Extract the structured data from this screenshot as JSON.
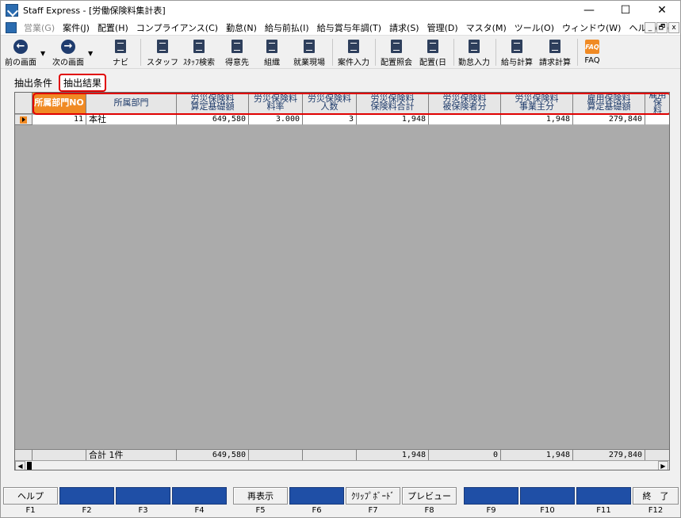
{
  "window": {
    "title": "Staff Express - [労働保険料集計表]",
    "controls": [
      "—",
      "☐",
      "✕"
    ]
  },
  "menu": {
    "items": [
      {
        "label": "営業(G)",
        "disabled": true
      },
      {
        "label": "案件(J)",
        "disabled": false
      },
      {
        "label": "配置(H)",
        "disabled": false
      },
      {
        "label": "コンプライアンス(C)",
        "disabled": false
      },
      {
        "label": "勤怠(N)",
        "disabled": false
      },
      {
        "label": "給与前払(I)",
        "disabled": false
      },
      {
        "label": "給与賞与年調(T)",
        "disabled": false
      },
      {
        "label": "請求(S)",
        "disabled": false
      },
      {
        "label": "管理(D)",
        "disabled": false
      },
      {
        "label": "マスタ(M)",
        "disabled": false
      },
      {
        "label": "ツール(O)",
        "disabled": false
      },
      {
        "label": "ウィンドウ(W)",
        "disabled": false
      },
      {
        "label": "ヘルプ(H)",
        "disabled": false
      }
    ],
    "mdi_controls": [
      "_",
      "🗗",
      "x"
    ]
  },
  "toolbar": {
    "back": "前の画面",
    "forward": "次の画面",
    "navi": "ナビ",
    "staff": "スタッフ",
    "staff_search": "ｽﾀｯﾌ検索",
    "client": "得意先",
    "org": "組織",
    "worksite": "就業現場",
    "case_input": "案件入力",
    "assign_inquiry": "配置照会",
    "assign_day": "配置(日",
    "attendance_input": "勤怠入力",
    "payroll_calc": "給与計算",
    "billing_calc": "請求計算",
    "faq": "FAQ",
    "faq_icon_text": "FAQ"
  },
  "tabs": {
    "conditions": "抽出条件",
    "results": "抽出結果"
  },
  "grid": {
    "headers": [
      "所属部門NO",
      "所属部門",
      "労災保険料\n算定基礎額",
      "労災保険料\n料率",
      "労災保険料\n人数",
      "労災保険料\n保険料合計",
      "労災保険料\n被保険者分",
      "労災保険料\n事業主分",
      "雇用保険料\n算定基礎額",
      "雇用保\n料"
    ],
    "rows": [
      [
        "11",
        "本社",
        "649,580",
        "3.000",
        "3",
        "1,948",
        "",
        "1,948",
        "279,840",
        ""
      ]
    ],
    "footer": [
      "",
      "合計 1件",
      "649,580",
      "",
      "",
      "1,948",
      "0",
      "1,948",
      "279,840",
      ""
    ]
  },
  "fkeys": [
    {
      "label": "ヘルプ",
      "key": "F1"
    },
    {
      "label": "",
      "key": "F2"
    },
    {
      "label": "",
      "key": "F3"
    },
    {
      "label": "",
      "key": "F4"
    },
    {
      "label": "再表示",
      "key": "F5"
    },
    {
      "label": "",
      "key": "F6"
    },
    {
      "label": "ｸﾘｯﾌﾟﾎﾞｰﾄﾞ",
      "key": "F7"
    },
    {
      "label": "プレビュー",
      "key": "F8"
    },
    {
      "label": "",
      "key": "F9"
    },
    {
      "label": "",
      "key": "F10"
    },
    {
      "label": "",
      "key": "F11"
    },
    {
      "label": "終　了",
      "key": "F12"
    }
  ],
  "colors": {
    "accent_orange": "#f08a24",
    "highlight_red": "#e00000",
    "fkey_blue": "#1f4fa6",
    "icon_navy": "#1f3c6e"
  }
}
